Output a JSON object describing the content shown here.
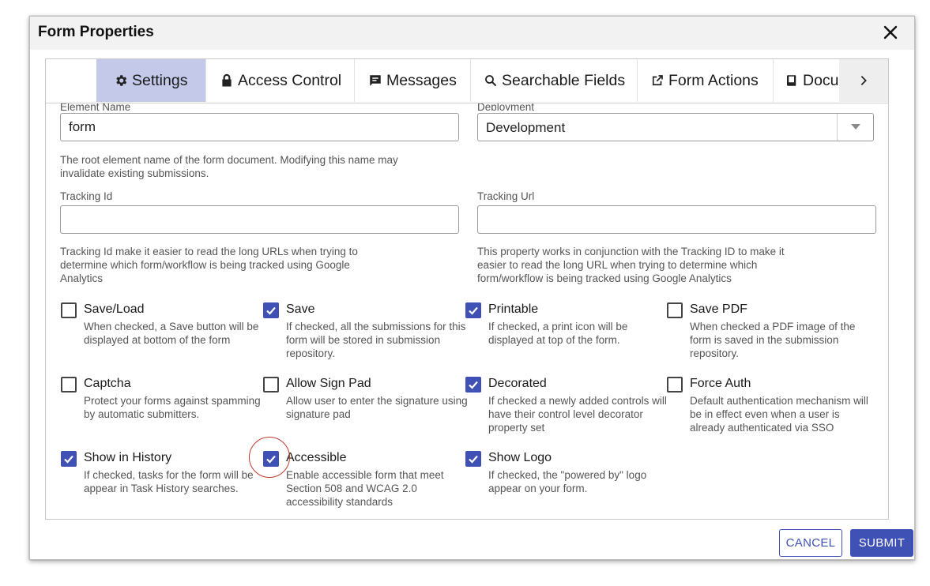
{
  "dialog": {
    "title": "Form Properties"
  },
  "tabs": [
    {
      "label": "Settings",
      "icon": "gear-icon",
      "active": true
    },
    {
      "label": "Access Control",
      "icon": "lock-icon"
    },
    {
      "label": "Messages",
      "icon": "message-icon"
    },
    {
      "label": "Searchable Fields",
      "icon": "search-icon"
    },
    {
      "label": "Form Actions",
      "icon": "external-link-icon"
    },
    {
      "label": "Docu",
      "icon": "book-icon"
    }
  ],
  "fields": {
    "element_name": {
      "label": "Element Name",
      "value": "form",
      "help": "The root element name of the form document. Modifying this name may invalidate existing submissions."
    },
    "deployment": {
      "label": "Deployment",
      "value": "Development"
    },
    "tracking_id": {
      "label": "Tracking Id",
      "value": "",
      "help": "Tracking Id make it easier to read the long URLs when trying to determine which form/workflow is being tracked using Google Analytics"
    },
    "tracking_url": {
      "label": "Tracking Url",
      "value": "",
      "help": "This property works in conjunction with the Tracking ID to make it easier to read the long URL when trying to determine which form/workflow is being tracked using Google Analytics"
    }
  },
  "options": [
    {
      "label": "Save/Load",
      "checked": false,
      "desc": "When checked, a Save button will be displayed at bottom of the form"
    },
    {
      "label": "Save",
      "checked": true,
      "desc": "If checked, all the submissions for this form will be stored in submission repository."
    },
    {
      "label": "Printable",
      "checked": true,
      "desc": "If checked, a print icon will be displayed at top of the form."
    },
    {
      "label": "Save PDF",
      "checked": false,
      "desc": "When checked a PDF image of the form is saved in the submission repository."
    },
    {
      "label": "Captcha",
      "checked": false,
      "desc": "Protect your forms against spamming by automatic submitters."
    },
    {
      "label": "Allow Sign Pad",
      "checked": false,
      "desc": "Allow user to enter the signature using signature pad"
    },
    {
      "label": "Decorated",
      "checked": true,
      "desc": "If checked a newly added controls will have their control level decorator property set"
    },
    {
      "label": "Force Auth",
      "checked": false,
      "desc": "Default authentication mechanism will be in effect even when a user is already authenticated via SSO"
    },
    {
      "label": "Show in History",
      "checked": true,
      "desc": "If checked, tasks for the form will be appear in Task History searches."
    },
    {
      "label": "Accessible",
      "checked": true,
      "desc": "Enable accessible form that meet Section 508 and WCAG 2.0 accessibility standards"
    },
    {
      "label": "Show Logo",
      "checked": true,
      "desc": "If checked, the \"powered by\" logo appear on your form."
    }
  ],
  "buttons": {
    "cancel": "CANCEL",
    "submit": "SUBMIT"
  },
  "colors": {
    "accent": "#3f51b5",
    "active_tab": "#c4c9ea",
    "annotation": "#c0392b"
  }
}
